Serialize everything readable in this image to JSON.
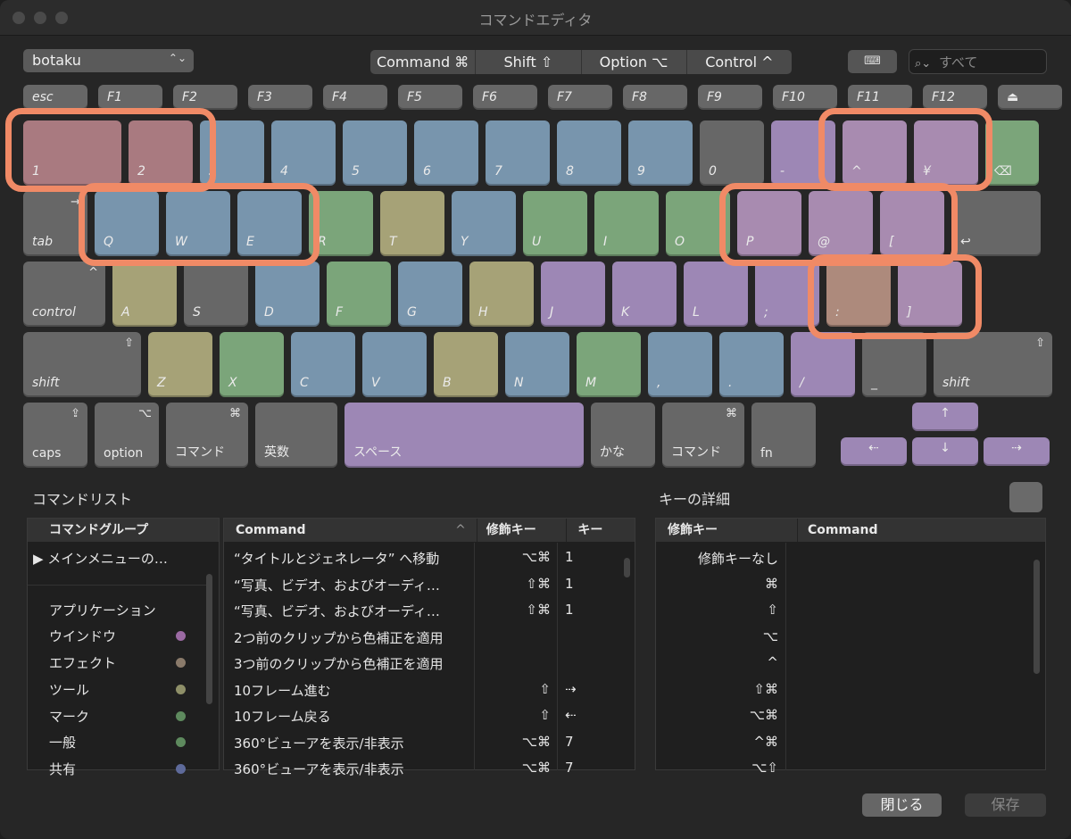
{
  "window": {
    "title": "コマンドエディタ"
  },
  "toolbar": {
    "preset": "botaku",
    "preset_chevron": "⌃⌄",
    "modifiers": [
      "Command ⌘",
      "Shift ⇧",
      "Option ⌥",
      "Control ^"
    ],
    "keyboard_icon": "⌨",
    "search_placeholder": "すべて"
  },
  "colors": {
    "highlight": "#f08a66",
    "accent_purple": "#9d87b5"
  },
  "keyboard": {
    "function_row": [
      {
        "label": "esc",
        "color": "gray"
      },
      {
        "label": "F1",
        "color": "gray"
      },
      {
        "label": "F2",
        "color": "gray"
      },
      {
        "label": "F3",
        "color": "gray"
      },
      {
        "label": "F4",
        "color": "gray"
      },
      {
        "label": "F5",
        "color": "gray"
      },
      {
        "label": "F6",
        "color": "gray"
      },
      {
        "label": "F7",
        "color": "gray"
      },
      {
        "label": "F8",
        "color": "gray"
      },
      {
        "label": "F9",
        "color": "gray"
      },
      {
        "label": "F10",
        "color": "gray"
      },
      {
        "label": "F11",
        "color": "gray"
      },
      {
        "label": "F12",
        "color": "gray"
      },
      {
        "label": "⏏",
        "color": "gray"
      }
    ],
    "number_row": [
      {
        "label": "1",
        "color": "red"
      },
      {
        "label": "2",
        "color": "red"
      },
      {
        "label": "3",
        "color": "blue"
      },
      {
        "label": "4",
        "color": "blue"
      },
      {
        "label": "5",
        "color": "blue"
      },
      {
        "label": "6",
        "color": "blue"
      },
      {
        "label": "7",
        "color": "blue"
      },
      {
        "label": "8",
        "color": "blue"
      },
      {
        "label": "9",
        "color": "blue"
      },
      {
        "label": "0",
        "color": "gray"
      },
      {
        "label": "-",
        "color": "purple"
      },
      {
        "label": "^",
        "color": "pink"
      },
      {
        "label": "¥",
        "color": "pink"
      },
      {
        "label": "⌫",
        "color": "green"
      }
    ],
    "qwerty_row": [
      {
        "label": "tab",
        "sym": "→",
        "color": "gray"
      },
      {
        "label": "Q",
        "color": "blue"
      },
      {
        "label": "W",
        "color": "blue"
      },
      {
        "label": "E",
        "color": "blue"
      },
      {
        "label": "R",
        "color": "green"
      },
      {
        "label": "T",
        "color": "yellow"
      },
      {
        "label": "Y",
        "color": "blue"
      },
      {
        "label": "U",
        "color": "green"
      },
      {
        "label": "I",
        "color": "green"
      },
      {
        "label": "O",
        "color": "green"
      },
      {
        "label": "P",
        "color": "pink"
      },
      {
        "label": "@",
        "color": "pink"
      },
      {
        "label": "[",
        "color": "pink"
      },
      {
        "label": "↩",
        "color": "gray"
      }
    ],
    "home_row": [
      {
        "label": "control",
        "sym": "^",
        "color": "gray"
      },
      {
        "label": "A",
        "color": "yellow"
      },
      {
        "label": "S",
        "color": "gray"
      },
      {
        "label": "D",
        "color": "blue"
      },
      {
        "label": "F",
        "color": "green"
      },
      {
        "label": "G",
        "color": "blue"
      },
      {
        "label": "H",
        "color": "yellow"
      },
      {
        "label": "J",
        "color": "purple"
      },
      {
        "label": "K",
        "color": "purple"
      },
      {
        "label": "L",
        "color": "purple"
      },
      {
        "label": ";",
        "color": "purple"
      },
      {
        "label": ":",
        "color": "tan"
      },
      {
        "label": "]",
        "color": "pink"
      }
    ],
    "shift_row": [
      {
        "label": "shift",
        "sym": "⇧",
        "color": "gray"
      },
      {
        "label": "Z",
        "color": "yellow"
      },
      {
        "label": "X",
        "color": "green"
      },
      {
        "label": "C",
        "color": "blue"
      },
      {
        "label": "V",
        "color": "blue"
      },
      {
        "label": "B",
        "color": "yellow"
      },
      {
        "label": "N",
        "color": "blue"
      },
      {
        "label": "M",
        "color": "green"
      },
      {
        "label": ",",
        "color": "blue"
      },
      {
        "label": ".",
        "color": "blue"
      },
      {
        "label": "/",
        "color": "purple"
      },
      {
        "label": "_",
        "color": "gray"
      },
      {
        "label": "shift",
        "sym": "⇧",
        "color": "gray"
      }
    ],
    "bottom_row": [
      {
        "label": "caps",
        "sym": "⇪",
        "color": "gray"
      },
      {
        "label": "option",
        "sym": "⌥",
        "color": "gray"
      },
      {
        "label": "コマンド",
        "sym": "⌘",
        "color": "gray"
      },
      {
        "label": "英数",
        "color": "gray"
      },
      {
        "label": "スペース",
        "color": "purple"
      },
      {
        "label": "かな",
        "color": "gray"
      },
      {
        "label": "コマンド",
        "sym": "⌘",
        "color": "gray"
      },
      {
        "label": "fn",
        "color": "gray"
      }
    ],
    "arrows": [
      {
        "label": "↑",
        "color": "purple"
      },
      {
        "label": "⇠",
        "color": "purple"
      },
      {
        "label": "↓",
        "color": "purple"
      },
      {
        "label": "⇢",
        "color": "purple"
      }
    ]
  },
  "command_list": {
    "title": "コマンドリスト",
    "group_header": "コマンドグループ",
    "groups": [
      {
        "label": "▶ メインメニューの…",
        "dot": ""
      },
      {
        "label": "アプリケーション",
        "dot": ""
      },
      {
        "label": "ウインドウ",
        "dot": "#9b6aa3"
      },
      {
        "label": "エフェクト",
        "dot": "#8a7a6a"
      },
      {
        "label": "ツール",
        "dot": "#8e8f68"
      },
      {
        "label": "マーク",
        "dot": "#5e8a5e"
      },
      {
        "label": "一般",
        "dot": "#5e8a5e"
      },
      {
        "label": "共有",
        "dot": "#5e6a9a"
      }
    ],
    "columns": [
      "Command",
      "修飾キー",
      "キー"
    ],
    "sort_indicator": "^",
    "rows": [
      {
        "cmd": "“タイトルとジェネレータ” へ移動",
        "mod": "⌥⌘",
        "key": "1"
      },
      {
        "cmd": "“写真、ビデオ、およびオーディ…",
        "mod": "⇧⌘",
        "key": "1"
      },
      {
        "cmd": "“写真、ビデオ、およびオーディ…",
        "mod": "⇧⌘",
        "key": "1"
      },
      {
        "cmd": "2つ前のクリップから色補正を適用",
        "mod": "",
        "key": ""
      },
      {
        "cmd": "3つ前のクリップから色補正を適用",
        "mod": "",
        "key": ""
      },
      {
        "cmd": "10フレーム進む",
        "mod": "⇧",
        "key": "⇢"
      },
      {
        "cmd": "10フレーム戻る",
        "mod": "⇧",
        "key": "⇠"
      },
      {
        "cmd": "360°ビューアを表示/非表示",
        "mod": "⌥⌘",
        "key": "7"
      },
      {
        "cmd": "360°ビューアを表示/非表示",
        "mod": "⌥⌘",
        "key": "7"
      }
    ]
  },
  "key_detail": {
    "title": "キーの詳細",
    "columns": [
      "修飾キー",
      "Command"
    ],
    "rows": [
      "修飾キーなし",
      "⌘",
      "⇧",
      "⌥",
      "^",
      "⇧⌘",
      "⌥⌘",
      "^⌘",
      "⌥⇧"
    ]
  },
  "footer": {
    "close_label": "閉じる",
    "save_label": "保存"
  }
}
